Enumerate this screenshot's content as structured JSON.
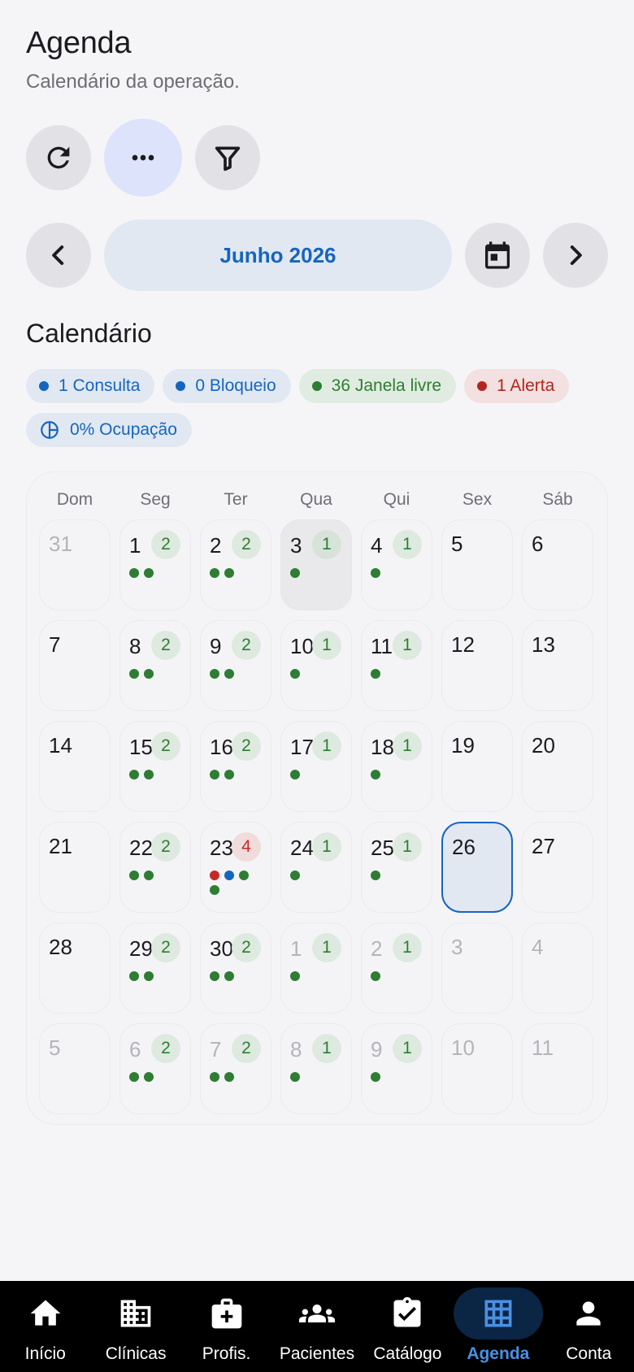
{
  "header": {
    "title": "Agenda",
    "subtitle": "Calendário da operação."
  },
  "actions": [
    {
      "name": "refresh-icon"
    },
    {
      "name": "more-icon"
    },
    {
      "name": "filter-icon"
    }
  ],
  "month_nav": {
    "label": "Junho 2026",
    "prev_icon": "chevron-left-icon",
    "picker_icon": "calendar-icon",
    "next_icon": "chevron-right-icon"
  },
  "calendar": {
    "section_title": "Calendário",
    "chips": [
      {
        "label": "1 Consulta",
        "color": "blue",
        "icon": "dot"
      },
      {
        "label": "0 Bloqueio",
        "color": "blue",
        "icon": "dot"
      },
      {
        "label": "36 Janela livre",
        "color": "green",
        "icon": "dot"
      },
      {
        "label": "1 Alerta",
        "color": "red",
        "icon": "dot"
      },
      {
        "label": "0% Ocupação",
        "color": "blue",
        "icon": "pie"
      }
    ],
    "weekdays": [
      "Dom",
      "Seg",
      "Ter",
      "Qua",
      "Qui",
      "Sex",
      "Sáb"
    ],
    "days": [
      {
        "day": "31",
        "muted": true,
        "badge": null,
        "dots": []
      },
      {
        "day": "1",
        "badge": "2",
        "dots": [
          "green",
          "green"
        ]
      },
      {
        "day": "2",
        "badge": "2",
        "dots": [
          "green",
          "green"
        ]
      },
      {
        "day": "3",
        "badge": "1",
        "dots": [
          "green"
        ],
        "selected": true
      },
      {
        "day": "4",
        "badge": "1",
        "dots": [
          "green"
        ]
      },
      {
        "day": "5",
        "badge": null,
        "dots": []
      },
      {
        "day": "6",
        "badge": null,
        "dots": []
      },
      {
        "day": "7",
        "badge": null,
        "dots": []
      },
      {
        "day": "8",
        "badge": "2",
        "dots": [
          "green",
          "green"
        ]
      },
      {
        "day": "9",
        "badge": "2",
        "dots": [
          "green",
          "green"
        ]
      },
      {
        "day": "10",
        "badge": "1",
        "dots": [
          "green"
        ]
      },
      {
        "day": "11",
        "badge": "1",
        "dots": [
          "green"
        ]
      },
      {
        "day": "12",
        "badge": null,
        "dots": []
      },
      {
        "day": "13",
        "badge": null,
        "dots": []
      },
      {
        "day": "14",
        "badge": null,
        "dots": []
      },
      {
        "day": "15",
        "badge": "2",
        "dots": [
          "green",
          "green"
        ]
      },
      {
        "day": "16",
        "badge": "2",
        "dots": [
          "green",
          "green"
        ]
      },
      {
        "day": "17",
        "badge": "1",
        "dots": [
          "green"
        ]
      },
      {
        "day": "18",
        "badge": "1",
        "dots": [
          "green"
        ]
      },
      {
        "day": "19",
        "badge": null,
        "dots": []
      },
      {
        "day": "20",
        "badge": null,
        "dots": []
      },
      {
        "day": "21",
        "badge": null,
        "dots": []
      },
      {
        "day": "22",
        "badge": "2",
        "dots": [
          "green",
          "green"
        ]
      },
      {
        "day": "23",
        "badge": "4",
        "badge_color": "red",
        "dots": [
          "red",
          "blue",
          "green",
          "green"
        ]
      },
      {
        "day": "24",
        "badge": "1",
        "dots": [
          "green"
        ]
      },
      {
        "day": "25",
        "badge": "1",
        "dots": [
          "green"
        ]
      },
      {
        "day": "26",
        "badge": null,
        "dots": [],
        "today": true
      },
      {
        "day": "27",
        "badge": null,
        "dots": []
      },
      {
        "day": "28",
        "badge": null,
        "dots": []
      },
      {
        "day": "29",
        "badge": "2",
        "dots": [
          "green",
          "green"
        ]
      },
      {
        "day": "30",
        "badge": "2",
        "dots": [
          "green",
          "green"
        ]
      },
      {
        "day": "1",
        "muted": true,
        "badge": "1",
        "dots": [
          "green"
        ]
      },
      {
        "day": "2",
        "muted": true,
        "badge": "1",
        "dots": [
          "green"
        ]
      },
      {
        "day": "3",
        "muted": true,
        "badge": null,
        "dots": []
      },
      {
        "day": "4",
        "muted": true,
        "badge": null,
        "dots": []
      },
      {
        "day": "5",
        "muted": true,
        "badge": null,
        "dots": []
      },
      {
        "day": "6",
        "muted": true,
        "badge": "2",
        "dots": [
          "green",
          "green"
        ]
      },
      {
        "day": "7",
        "muted": true,
        "badge": "2",
        "dots": [
          "green",
          "green"
        ]
      },
      {
        "day": "8",
        "muted": true,
        "badge": "1",
        "dots": [
          "green"
        ]
      },
      {
        "day": "9",
        "muted": true,
        "badge": "1",
        "dots": [
          "green"
        ]
      },
      {
        "day": "10",
        "muted": true,
        "badge": null,
        "dots": []
      },
      {
        "day": "11",
        "muted": true,
        "badge": null,
        "dots": []
      }
    ]
  },
  "bottom_nav": [
    {
      "label": "Início",
      "icon": "home-icon"
    },
    {
      "label": "Clínicas",
      "icon": "building-icon"
    },
    {
      "label": "Profis.",
      "icon": "medical-bag-icon"
    },
    {
      "label": "Pacientes",
      "icon": "people-icon"
    },
    {
      "label": "Catálogo",
      "icon": "clipboard-check-icon"
    },
    {
      "label": "Agenda",
      "icon": "grid-icon",
      "active": true
    },
    {
      "label": "Conta",
      "icon": "person-icon"
    }
  ],
  "colors": {
    "accent": "#1565c0",
    "success": "#2e7d32",
    "danger": "#c62828",
    "background": "#f5f5f8",
    "nav_background": "#000000"
  }
}
